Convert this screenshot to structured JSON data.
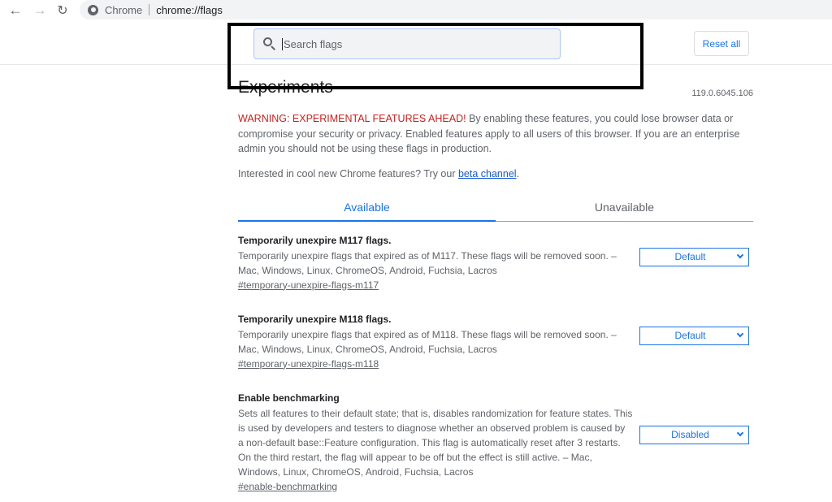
{
  "browser": {
    "back_icon": "arrow-left-icon",
    "forward_icon": "arrow-right-icon",
    "reload_icon": "reload-icon",
    "site_chip": "Chrome",
    "url": "chrome://flags"
  },
  "header": {
    "search_placeholder": "Search flags",
    "search_value": "",
    "reset_label": "Reset all"
  },
  "page": {
    "title": "Experiments",
    "version": "119.0.6045.106",
    "warning_label": "WARNING: EXPERIMENTAL FEATURES AHEAD!",
    "warning_text": " By enabling these features, you could lose browser data or compromise your security or privacy. Enabled features apply to all users of this browser. If you are an enterprise admin you should not be using these flags in production.",
    "beta_prefix": "Interested in cool new Chrome features? Try our ",
    "beta_link": "beta channel",
    "beta_suffix": "."
  },
  "tabs": [
    {
      "label": "Available",
      "active": true
    },
    {
      "label": "Unavailable",
      "active": false
    }
  ],
  "flags": [
    {
      "name": "Temporarily unexpire M117 flags.",
      "description": "Temporarily unexpire flags that expired as of M117. These flags will be removed soon. – Mac, Windows, Linux, ChromeOS, Android, Fuchsia, Lacros",
      "link": "#temporary-unexpire-flags-m117",
      "value": "Default"
    },
    {
      "name": "Temporarily unexpire M118 flags.",
      "description": "Temporarily unexpire flags that expired as of M118. These flags will be removed soon. – Mac, Windows, Linux, ChromeOS, Android, Fuchsia, Lacros",
      "link": "#temporary-unexpire-flags-m118",
      "value": "Default"
    },
    {
      "name": "Enable benchmarking",
      "description": "Sets all features to their default state; that is, disables randomization for feature states. This is used by developers and testers to diagnose whether an observed problem is caused by a non-default base::Feature configuration. This flag is automatically reset after 3 restarts. On the third restart, the flag will appear to be off but the effect is still active. – Mac, Windows, Linux, ChromeOS, Android, Fuchsia, Lacros",
      "link": "#enable-benchmarking",
      "value": "Disabled"
    }
  ],
  "colors": {
    "accent": "#1a73e8",
    "warning": "#c5221f",
    "annotation_box": "#000000"
  }
}
